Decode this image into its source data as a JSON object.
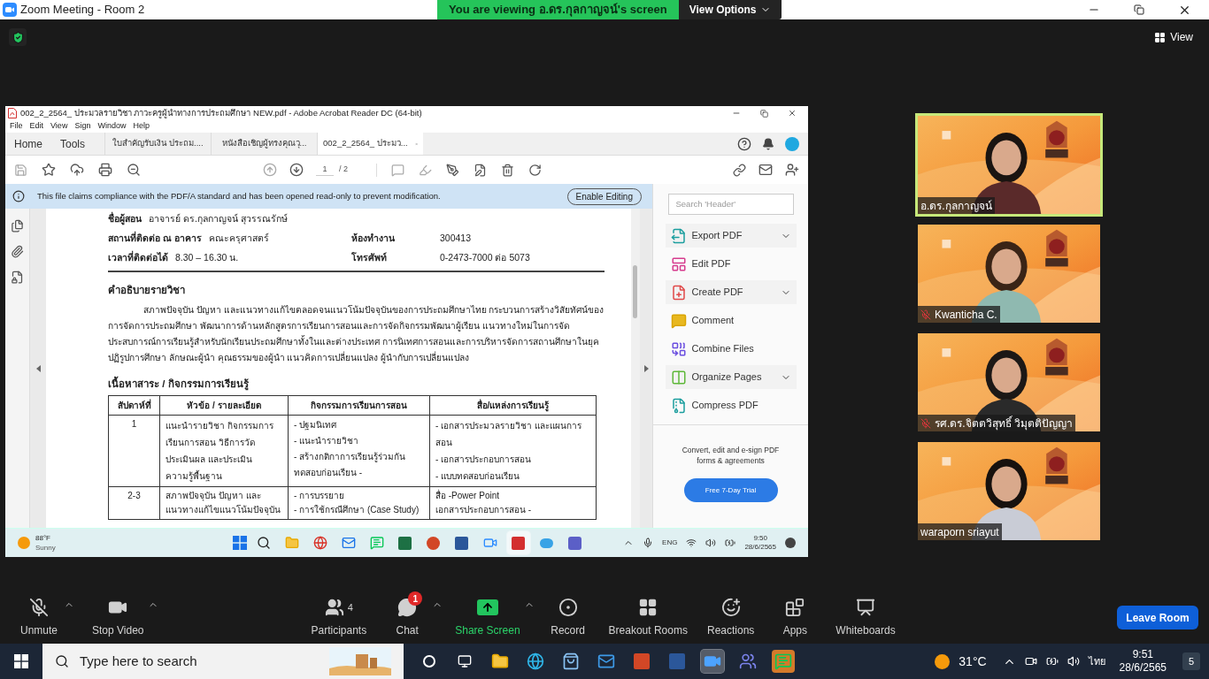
{
  "window": {
    "title": "Zoom Meeting - Room 2"
  },
  "share_banner": {
    "text": "You are viewing อ.ดร.กุลกาญจน์'s screen",
    "options": "View Options"
  },
  "view_button": "View",
  "shared_screen": {
    "title": "002_2_2564_ ประมวลรายวิชา ภาวะครูผู้นำทางการประถมศึกษา NEW.pdf - Adobe Acrobat Reader DC (64-bit)",
    "menu": [
      "File",
      "Edit",
      "View",
      "Sign",
      "Window",
      "Help"
    ],
    "nav": [
      "Home",
      "Tools"
    ],
    "tabs": [
      {
        "label": "ใบสำคัญรับเงิน ประถม....",
        "selected": false
      },
      {
        "label": "หนังสือเชิญผู้ทรงคุณวุ...",
        "selected": false
      },
      {
        "label": "002_2_2564_ ประมว...",
        "selected": true
      }
    ],
    "page": {
      "current": "1",
      "total": "/ 2"
    },
    "notice": "This file claims compliance with the PDF/A standard and has been opened read-only to prevent modification.",
    "enable_editing": "Enable Editing",
    "document": {
      "info": [
        {
          "label": "ชื่อผู้สอน",
          "value": "อาจารย์ ดร.กุลกาญจน์ สุวรรณรักษ์"
        },
        {
          "label": "สถานที่ติดต่อ ณ อาคาร",
          "value": "คณะครุศาสตร์",
          "label2": "ห้องทำงาน",
          "value2": "300413"
        },
        {
          "label": "เวลาที่ติดต่อได้",
          "value": "8.30 – 16.30 น.",
          "label2": "โทรศัพท์",
          "value2": "0-2473-7000 ต่อ 5073"
        }
      ],
      "description_heading": "คำอธิบายรายวิชา",
      "description": "สภาพปัจจุบัน ปัญหา และแนวทางแก้ไขตลอดจนแนวโน้มปัจจุบันของการประถมศึกษาไทย กระบวนการสร้างวิสัยทัศน์ของการจัดการประถมศึกษา พัฒนาการด้านหลักสูตรการเรียนการสอนและการจัดกิจกรรมพัฒนาผู้เรียน แนวทางใหม่ในการจัดประสบการณ์การเรียนรู้สำหรับนักเรียนประถมศึกษาทั้งในและต่างประเทศ การนิเทศการสอนและการบริหารจัดการสถานศึกษาในยุคปฏิรูปการศึกษา ลักษณะผู้นำ คุณธรรมของผู้นำ แนวคิดการเปลี่ยนแปลง ผู้นำกับการเปลี่ยนแปลง",
      "content_heading": "เนื้อหาสาระ / กิจกรรมการเรียนรู้",
      "table": {
        "columns": [
          "สัปดาห์ที่",
          "หัวข้อ / รายละเอียด",
          "กิจกรรมการเรียนการสอน",
          "สื่อ/แหล่งการเรียนรู้"
        ],
        "rows": [
          {
            "week": "1",
            "topic": [
              "แนะนำรายวิชา กิจกรรมการ",
              "เรียนการสอน วิธีการวัด",
              "ประเมินผล และประเมิน",
              "ความรู้พื้นฐาน"
            ],
            "activities": [
              "- ปฐมนิเทศ",
              "- แนะนำรายวิชา",
              "- สร้างกติกาการเรียนรู้ร่วมกัน ทดสอบก่อนเรียน -"
            ],
            "media": [
              "- เอกสารประมวลรายวิชา และแผนการสอน",
              "- เอกสารประกอบการสอน",
              "- แบบทดสอบก่อนเรียน"
            ]
          },
          {
            "week": "2-3",
            "topic": [
              "สภาพปัจจุบัน ปัญหา และ",
              "แนวทางแก้ไขแนวโน้มปัจจุบัน"
            ],
            "activities": [
              "- การบรรยาย",
              "- การใช้กรณีศึกษา (Case Study)"
            ],
            "media": [
              "สื่อ -Power Point",
              "เอกสารประกอบการสอน -"
            ]
          }
        ]
      }
    },
    "tools_panel": {
      "search_placeholder": "Search 'Header'",
      "items": [
        {
          "label": "Export PDF",
          "expandable": true
        },
        {
          "label": "Edit PDF",
          "expandable": false
        },
        {
          "label": "Create PDF",
          "expandable": true
        },
        {
          "label": "Comment",
          "expandable": false
        },
        {
          "label": "Combine Files",
          "expandable": false
        },
        {
          "label": "Organize Pages",
          "expandable": true
        },
        {
          "label": "Compress PDF",
          "expandable": false
        }
      ],
      "promo": "Convert, edit and e-sign PDF forms & agreements",
      "trial": "Free 7-Day Trial"
    },
    "taskbar": {
      "temperature": "88°F",
      "condition": "Sunny",
      "language": "ENG",
      "time": "9:50",
      "date": "28/6/2565"
    }
  },
  "participants": [
    {
      "name": "อ.ดร.กุลกาญจน์",
      "muted": false,
      "active_speaker": true
    },
    {
      "name": "Kwanticha C.",
      "muted": true,
      "active_speaker": false
    },
    {
      "name": "รศ.ดร.จิตตวิสุทธิ์ วิมุตติปัญญา",
      "muted": true,
      "active_speaker": false
    },
    {
      "name": "waraporn sriayut",
      "muted": false,
      "active_speaker": false
    }
  ],
  "toolbar": {
    "left": [
      {
        "kind": "audio",
        "label": "Unmute",
        "caret": true
      },
      {
        "kind": "video",
        "label": "Stop Video",
        "caret": true
      }
    ],
    "center": [
      {
        "kind": "participants",
        "label": "Participants",
        "count": "4",
        "caret": false
      },
      {
        "kind": "chat",
        "label": "Chat",
        "badge": "1",
        "caret": true
      },
      {
        "kind": "share",
        "label": "Share Screen",
        "caret": true
      },
      {
        "kind": "record",
        "label": "Record",
        "caret": false
      },
      {
        "kind": "breakout",
        "label": "Breakout Rooms",
        "caret": false
      },
      {
        "kind": "reactions",
        "label": "Reactions",
        "caret": false
      },
      {
        "kind": "apps",
        "label": "Apps",
        "caret": false
      },
      {
        "kind": "whiteboards",
        "label": "Whiteboards",
        "caret": false
      }
    ],
    "leave": "Leave Room"
  },
  "taskbar": {
    "search_placeholder": "Type here to search",
    "temperature": "31°C",
    "language": "ไทย",
    "time": "9:51",
    "date": "28/6/2565",
    "notifications": "5"
  }
}
